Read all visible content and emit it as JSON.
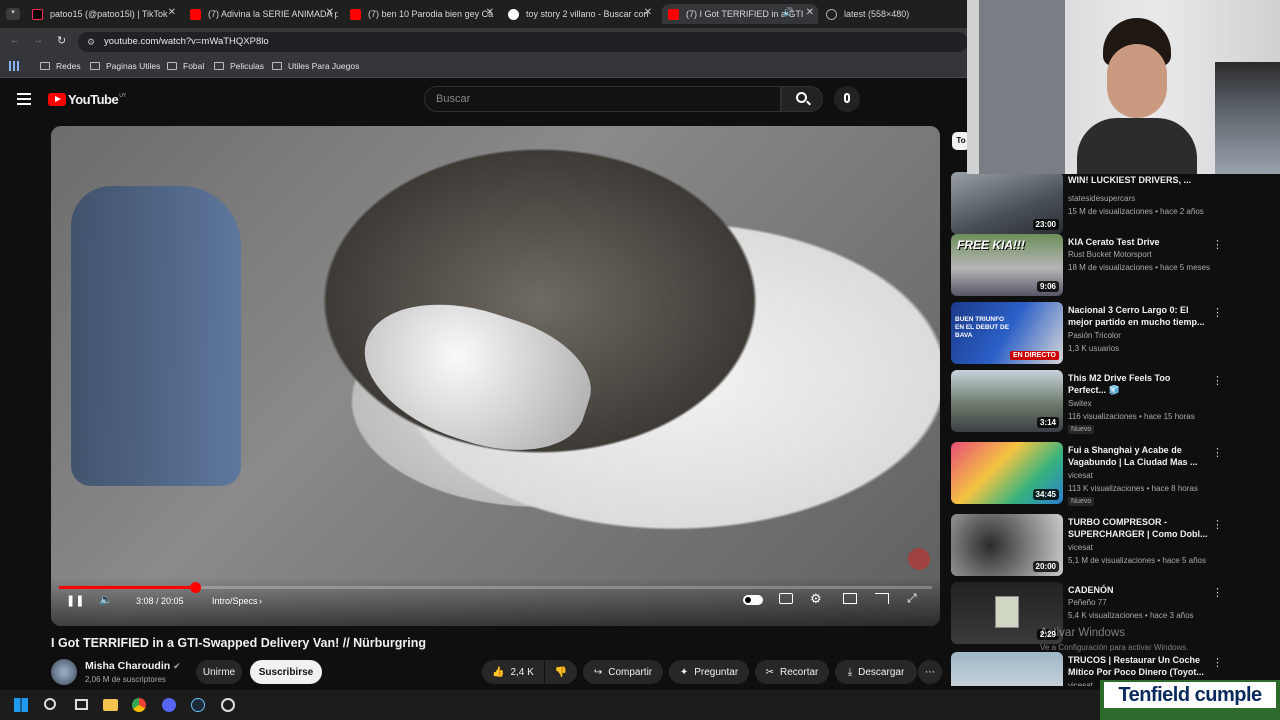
{
  "browser": {
    "tabs": [
      {
        "title": "patoo15 (@patoo15l) | TikTok"
      },
      {
        "title": "(7) Adivina la SERIE ANIMADA p"
      },
      {
        "title": "(7) ben 10 Parodia bien gey Ca"
      },
      {
        "title": "toy story 2 villano - Buscar con"
      },
      {
        "title": "(7) I Got TERRIFIED in a GTI"
      },
      {
        "title": "latest (558×480)"
      }
    ],
    "url": "youtube.com/watch?v=mWaTHQXP8lo",
    "bookmarks": [
      "Redes",
      "Paginas Utiles",
      "Fobal",
      "Peliculas",
      "Utiles Para Juegos"
    ]
  },
  "youtube": {
    "logo": "YouTube",
    "country": "UY",
    "search_placeholder": "Buscar"
  },
  "player": {
    "time": "3:08 / 20:05",
    "chapter": "Intro/Specs",
    "progress_fraction": 0.156
  },
  "video": {
    "title": "I Got TERRIFIED in a GTI-Swapped Delivery Van! // Nürburgring",
    "channel": "Misha Charoudin",
    "subscribers": "2,06 M de suscriptores",
    "join_label": "Unirme",
    "subscribe_label": "Suscribirse",
    "likes": "2,4 K",
    "share_label": "Compartir",
    "ask_label": "Preguntar",
    "clip_label": "Recortar",
    "download_label": "Descargar"
  },
  "sidebar": {
    "chip": "To",
    "items": [
      {
        "title": "WIN! LUCKIEST DRIVERS, ...",
        "channel": "statesidesupercars",
        "meta": "15 M de visualizaciones • hace 2 años",
        "duration": "23:00"
      },
      {
        "title": "KIA Cerato Test Drive",
        "channel": "Rust Bucket Motorsport",
        "meta": "18 M de visualizaciones • hace 5 meses",
        "duration": "9:06",
        "thumb_text": "FREE KIA!!!"
      },
      {
        "title": "Nacional 3 Cerro Largo 0: El mejor partido en mucho tiemp...",
        "channel": "Pasión Tricolor",
        "meta": "1,3 K usuarios",
        "duration": "EN DIRECTO",
        "thumb_text": "BUEN TRIUNFO EN EL DEBUT DE BAVA"
      },
      {
        "title": "This M2 Drive Feels Too Perfect... 🧊",
        "channel": "Switex",
        "meta": "116 visualizaciones • hace 15 horas",
        "badge": "Nuevo",
        "duration": "3:14"
      },
      {
        "title": "Fui a Shanghai y Acabe de Vagabundo | La Ciudad Mas ...",
        "channel": "vicesat",
        "meta": "113 K visualizaciones • hace 8 horas",
        "badge": "Nuevo",
        "duration": "34:45"
      },
      {
        "title": "TURBO COMPRESOR - SUPERCHARGER | Como Dobl...",
        "channel": "vicesat",
        "meta": "5,1 M de visualizaciones • hace 5 años",
        "duration": "20:00"
      },
      {
        "title": "CADENÓN",
        "channel": "Peñeño 77",
        "meta": "5,4 K visualizaciones • hace 3 años",
        "duration": "2:29"
      },
      {
        "title": "TRUCOS | Restaurar Un Coche Mitico Por Poco Dinero (Toyot...",
        "channel": "vicesat",
        "meta": "",
        "duration": ""
      }
    ]
  },
  "overlay": {
    "activate_title": "Activar Windows",
    "activate_sub": "Ve a Configuración para activar Windows.",
    "brand": "Tenfield cumple"
  },
  "colors": {
    "accent": "#ff0000",
    "bg": "#0f0f0f",
    "live": "#cc0000"
  }
}
